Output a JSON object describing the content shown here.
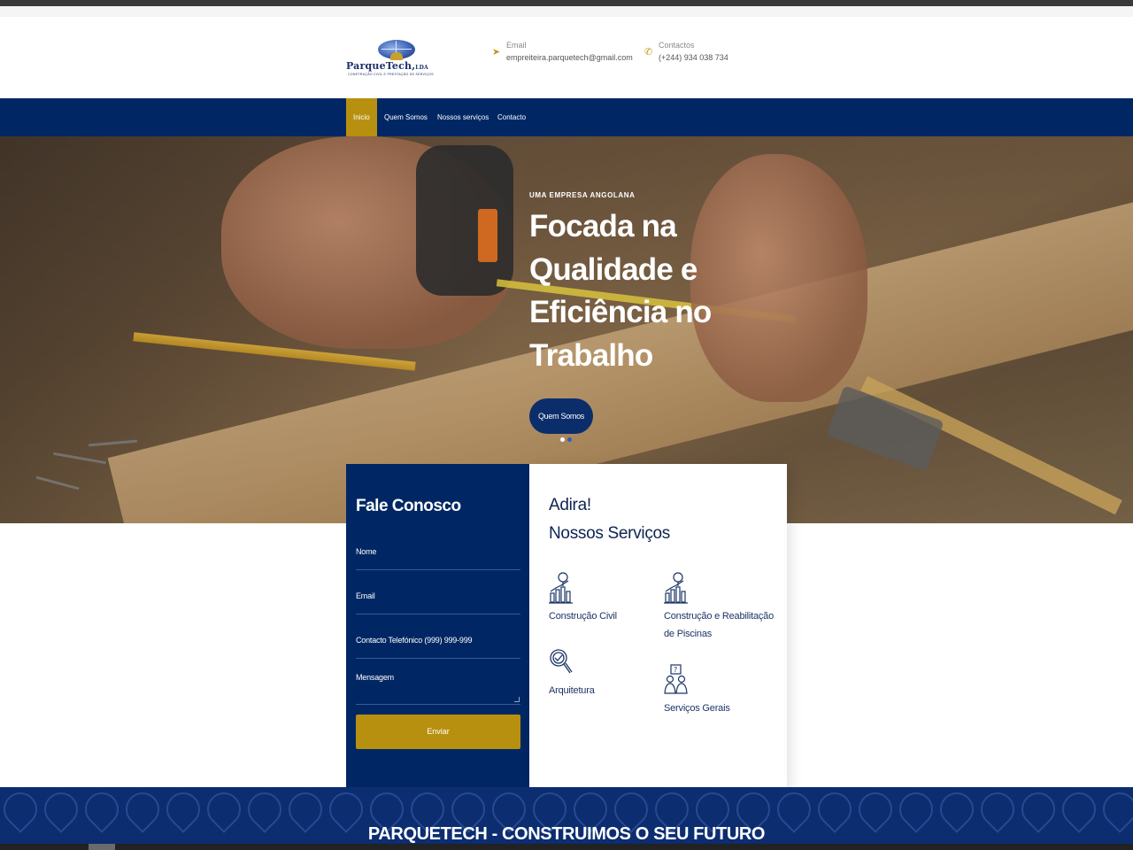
{
  "header": {
    "logo_name": "ParqueTech,",
    "logo_suffix": "LDA",
    "logo_tagline": "CONSTRUÇÃO CIVIL E PRESTAÇÃO DE SERVIÇOS",
    "email_label": "Email",
    "email_value": "empreiteira.parquetech@gmail.com",
    "phone_label": "Contactos",
    "phone_value": "(+244) 934 038 734"
  },
  "nav": {
    "items": [
      {
        "label": "Inicio",
        "active": true
      },
      {
        "label": "Quem Somos",
        "active": false
      },
      {
        "label": "Nossos serviços",
        "active": false
      },
      {
        "label": "Contacto",
        "active": false
      }
    ]
  },
  "hero": {
    "eyebrow": "UMA EMPRESA ANGOLANA",
    "headline": "Focada na Qualidade e Eficiência no Trabalho",
    "button_label": "Quem Somos",
    "slide_count": 2,
    "active_slide": 1
  },
  "contact_form": {
    "title": "Fale Conosco",
    "fields": {
      "name_placeholder": "Nome",
      "email_placeholder": "Email",
      "phone_placeholder": "Contacto Telefónico (999) 999-999",
      "message_placeholder": "Mensagem"
    },
    "submit_label": "Enviar"
  },
  "services": {
    "title_line1": "Adira!",
    "title_line2": "Nossos Serviços",
    "items": [
      {
        "label": "Construção Civil",
        "icon": "building-chart-icon"
      },
      {
        "label": "Construção e Reabilitação de Piscinas",
        "icon": "building-chart-icon"
      },
      {
        "label": "Arquitetura",
        "icon": "magnifier-check-icon"
      },
      {
        "label": "Serviços Gerais",
        "icon": "people-question-icon"
      }
    ]
  },
  "footer": {
    "title": "PARQUETECH - CONSTRUIMOS O SEU FUTURO"
  },
  "colors": {
    "navy": "#002764",
    "gold": "#b8900f",
    "text_dark": "#0d2452"
  }
}
